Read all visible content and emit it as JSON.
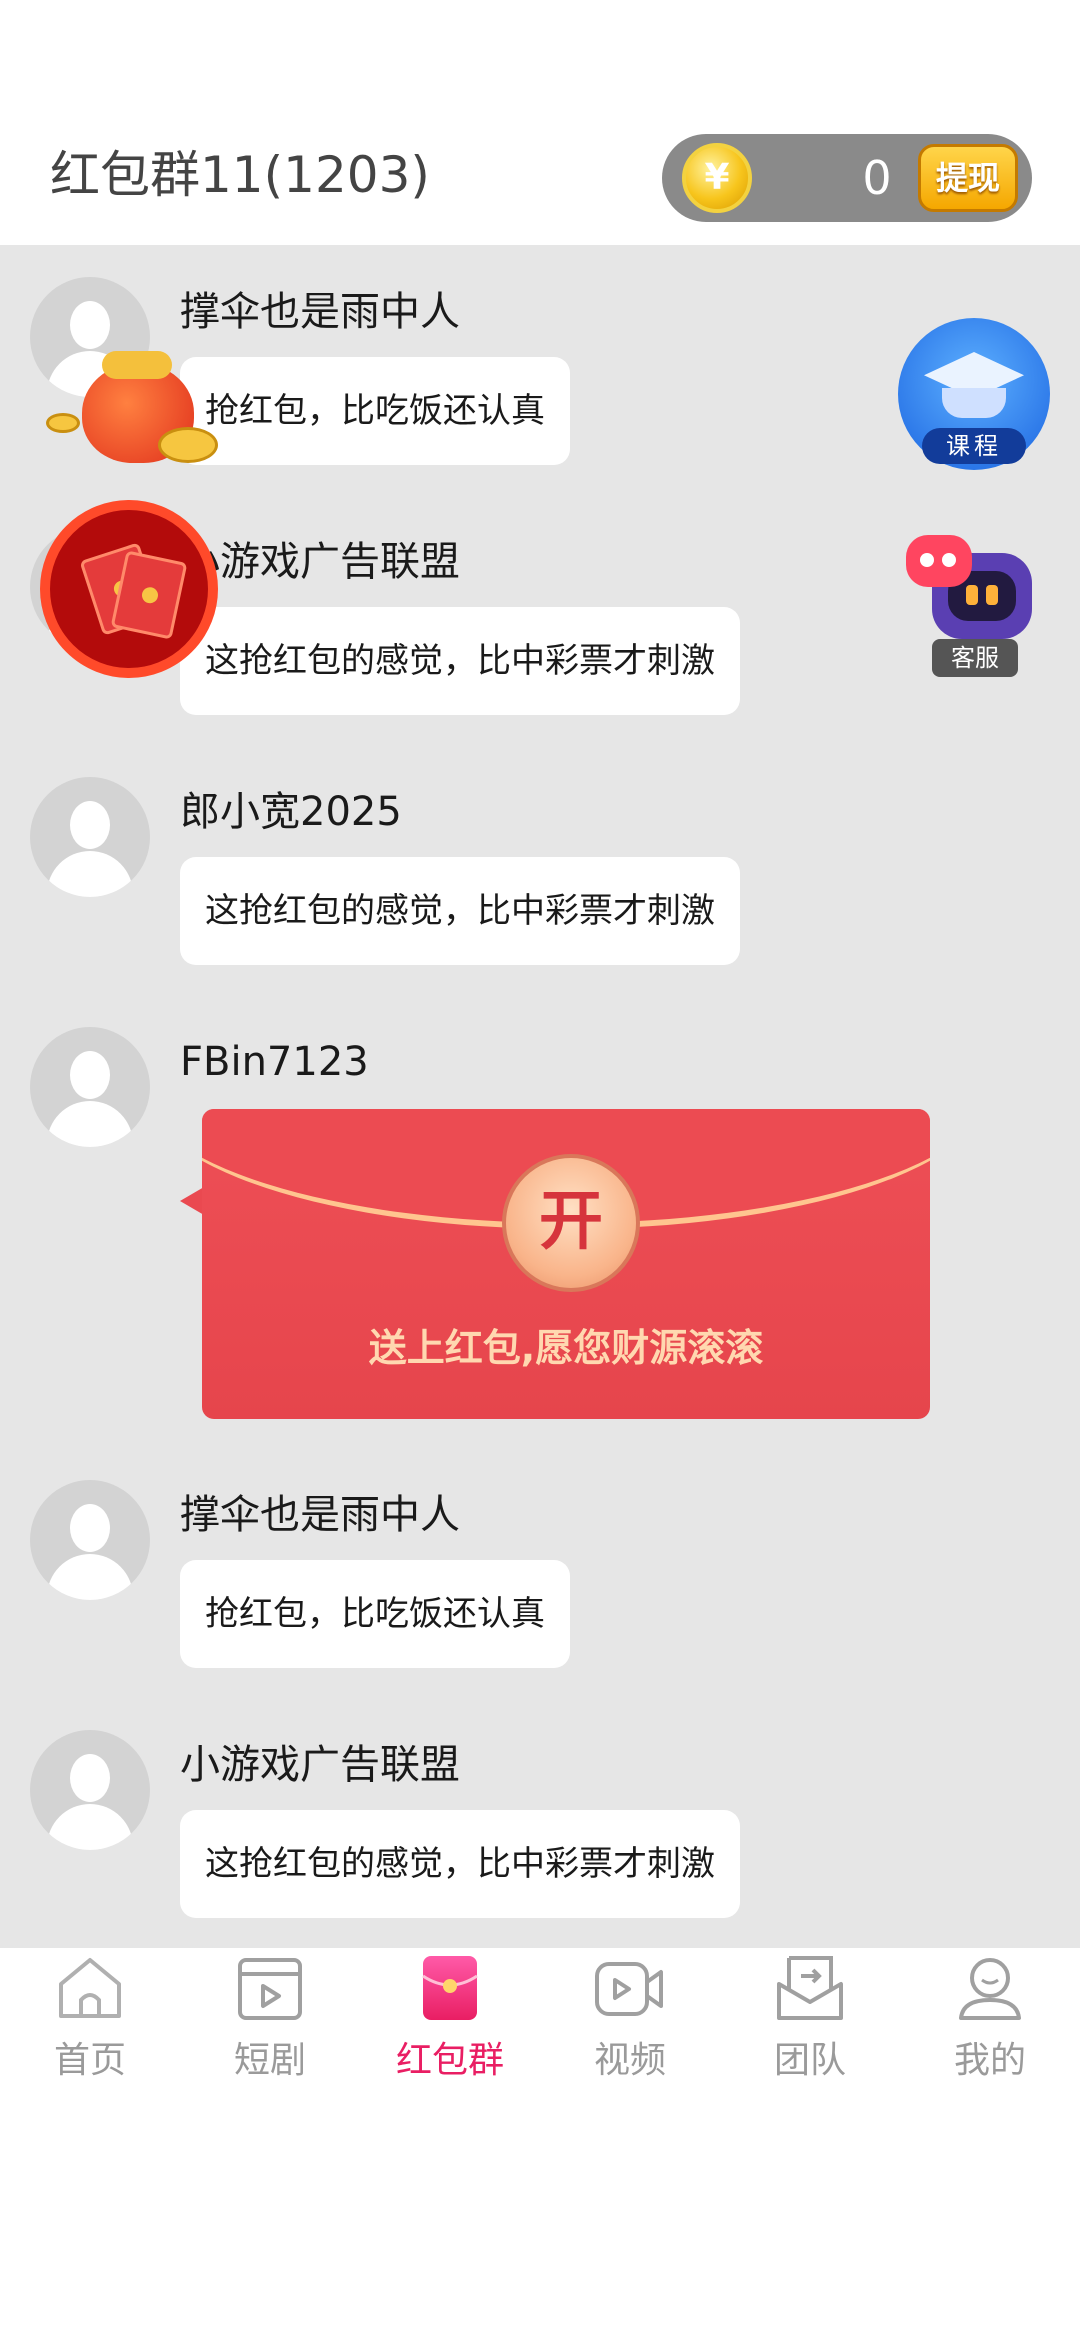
{
  "header": {
    "group_title": "红包群11(1203)",
    "coin_symbol": "¥",
    "balance": "0",
    "withdraw_label": "提现"
  },
  "messages": [
    {
      "sender": "撑伞也是雨中人",
      "text": "抢红包，比吃饭还认真",
      "type": "text"
    },
    {
      "sender": "小游戏广告联盟",
      "text": "这抢红包的感觉，比中彩票才刺激",
      "type": "text"
    },
    {
      "sender": "郎小宽2025",
      "text": "这抢红包的感觉，比中彩票才刺激",
      "type": "text"
    },
    {
      "sender": "FBin7123",
      "type": "red_packet",
      "open_label": "开",
      "caption": "送上红包,愿您财源滚滚"
    },
    {
      "sender": "撑伞也是雨中人",
      "text": "抢红包，比吃饭还认真",
      "type": "text"
    },
    {
      "sender": "小游戏广告联盟",
      "text": "这抢红包的感觉，比中彩票才刺激",
      "type": "text"
    }
  ],
  "floating": {
    "course_label": "课程",
    "service_label": "客服"
  },
  "tabs": [
    {
      "label": "首页",
      "icon": "home-icon",
      "active": false
    },
    {
      "label": "短剧",
      "icon": "short-drama-icon",
      "active": false
    },
    {
      "label": "红包群",
      "icon": "red-packet-icon",
      "active": true
    },
    {
      "label": "视频",
      "icon": "video-icon",
      "active": false
    },
    {
      "label": "团队",
      "icon": "team-icon",
      "active": false
    },
    {
      "label": "我的",
      "icon": "profile-icon",
      "active": false
    }
  ],
  "colors": {
    "accent": "#e91e63",
    "red_packet": "#ea4950",
    "chat_background": "#e6e6e6"
  }
}
